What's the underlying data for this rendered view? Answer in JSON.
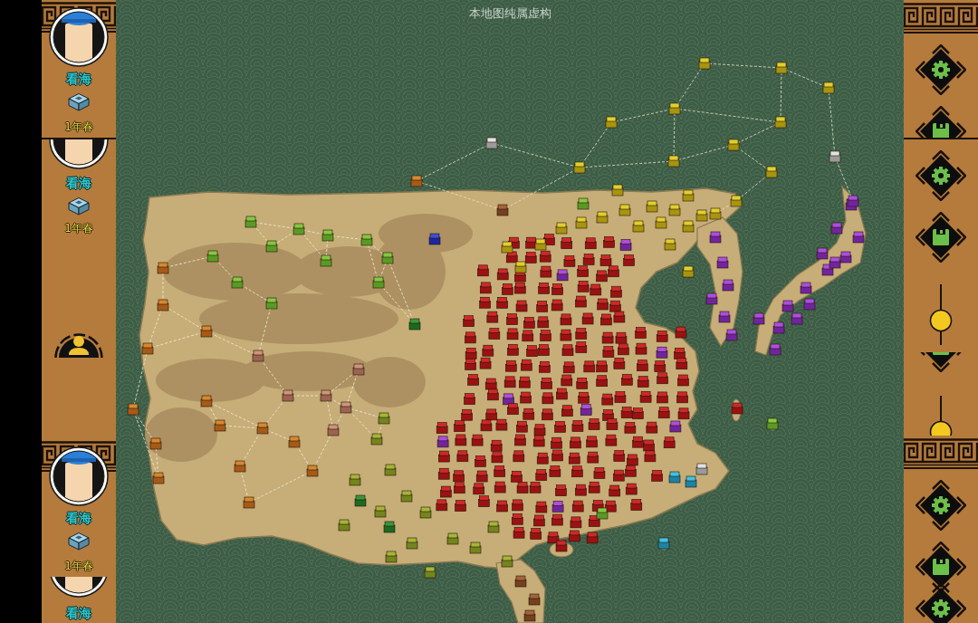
{
  "left_panel": {
    "segments": [
      {
        "kind": "card",
        "name": "看海",
        "date": "1年春"
      },
      {
        "kind": "card_mid",
        "name": "看海",
        "date": "1年春"
      },
      {
        "kind": "profile_button"
      },
      {
        "kind": "card",
        "name": "看海",
        "date": "1年春"
      },
      {
        "kind": "card_low",
        "name": "看海"
      }
    ]
  },
  "map": {
    "notice": "本地图纯属虚构"
  },
  "right_panel": {
    "segments": [
      {
        "kind": "bordered",
        "items": [
          {
            "kind": "gear"
          },
          {
            "kind": "save_top"
          }
        ]
      },
      {
        "kind": "plain",
        "items": [
          {
            "kind": "gear"
          },
          {
            "kind": "save"
          },
          {
            "kind": "slider",
            "level": 0.4
          },
          {
            "kind": "save_tip"
          },
          {
            "kind": "slider_top",
            "level": 0.4
          }
        ]
      },
      {
        "kind": "bordered",
        "items": [
          {
            "kind": "gear"
          },
          {
            "kind": "save"
          },
          {
            "kind": "gear_top"
          }
        ]
      }
    ]
  }
}
